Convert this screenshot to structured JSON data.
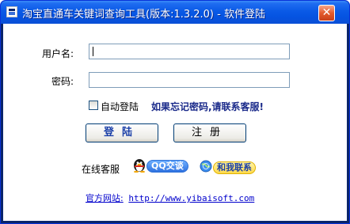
{
  "window": {
    "title": "淘宝直通车关键词查询工具(版本:1.3.2.0) - 软件登陆",
    "close_glyph": "✕"
  },
  "form": {
    "username_label": "用户名:",
    "username_value": "",
    "password_label": "密码:",
    "password_value": "",
    "auto_login_label": "自动登陆",
    "auto_login_checked": false,
    "forgot_text": "如果忘记密码,请联系客服!"
  },
  "buttons": {
    "login_label": "登陆",
    "register_label": "注册"
  },
  "support": {
    "label": "在线客服",
    "qq_label": "QQ交谈",
    "contact_label": "和我联系"
  },
  "footer": {
    "site_label": "官方网站:",
    "site_url": "http://www.yibaisoft.com"
  }
}
